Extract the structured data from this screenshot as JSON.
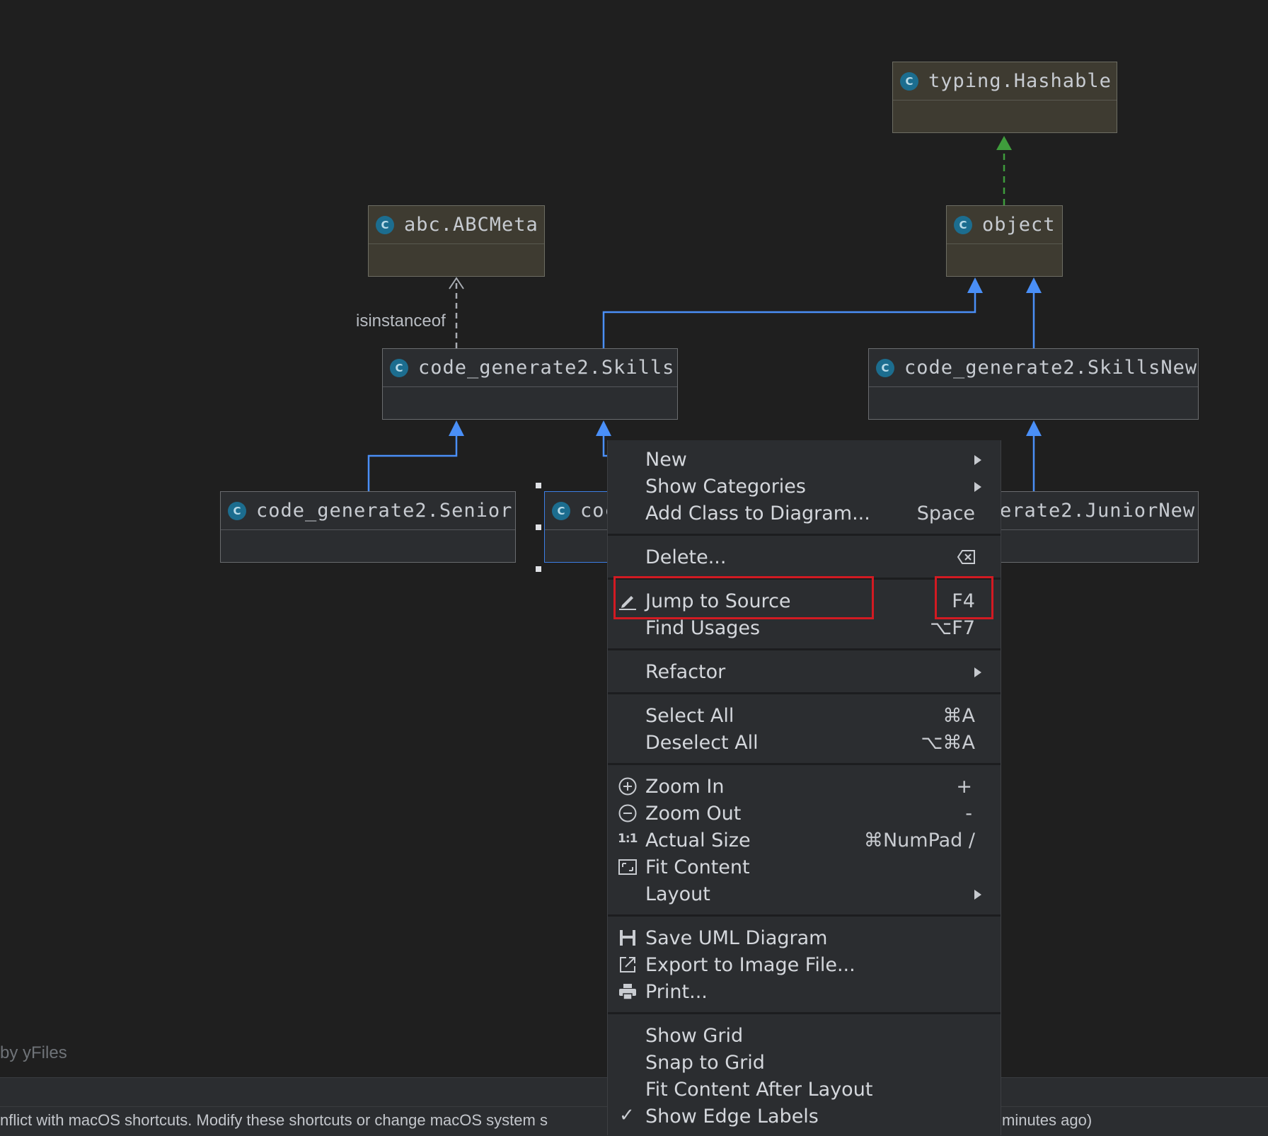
{
  "diagram": {
    "nodes": {
      "hashable": "typing.Hashable",
      "object": "object",
      "abcmeta": "abc.ABCMeta",
      "skills": "code_generate2.Skills",
      "skills_new": "code_generate2.SkillsNew",
      "senior": "code_generate2.Senior",
      "junior_partial": "coc",
      "junior_new_partial": "erate2.JuniorNew"
    },
    "class_icon_letter": "C",
    "edge_label": "isinstanceof",
    "colors": {
      "background": "#1f1f1f",
      "inherit_edge": "#4a8ff7",
      "implement_edge": "#3f9c3c",
      "dependency_edge": "#a9adb3"
    }
  },
  "watermark": "by yFiles",
  "status": {
    "left_text": "nflict with macOS shortcuts. Modify these shortcuts or change macOS system s",
    "right_text": "minutes ago)"
  },
  "context_menu": {
    "items": [
      {
        "label": "New",
        "submenu": true
      },
      {
        "label": "Show Categories",
        "submenu": true
      },
      {
        "label": "Add Class to Diagram...",
        "shortcut": "Space"
      },
      {
        "label": "Delete...",
        "icon": "delete-key-icon"
      },
      {
        "label": "Jump to Source",
        "shortcut": "F4",
        "icon": "pencil-icon",
        "highlighted": true
      },
      {
        "label": "Find Usages",
        "shortcut": "⌥F7"
      },
      {
        "label": "Refactor",
        "submenu": true
      },
      {
        "label": "Select All",
        "shortcut": "⌘A"
      },
      {
        "label": "Deselect All",
        "shortcut": "⌥⌘A"
      },
      {
        "label": "Zoom In",
        "shortcut": "+",
        "icon": "zoom-in-icon"
      },
      {
        "label": "Zoom Out",
        "shortcut": "-",
        "icon": "zoom-out-icon"
      },
      {
        "label": "Actual Size",
        "shortcut": "⌘NumPad /",
        "icon": "actual-size-icon",
        "icon_text": "1:1"
      },
      {
        "label": "Fit Content",
        "icon": "fit-content-icon"
      },
      {
        "label": "Layout",
        "submenu": true
      },
      {
        "label": "Save UML Diagram",
        "icon": "save-icon"
      },
      {
        "label": "Export to Image File...",
        "icon": "export-icon"
      },
      {
        "label": "Print...",
        "icon": "printer-icon"
      },
      {
        "label": "Show Grid"
      },
      {
        "label": "Snap to Grid"
      },
      {
        "label": "Fit Content After Layout"
      },
      {
        "label": "Show Edge Labels",
        "checked": true,
        "check_mark": "✓"
      }
    ],
    "highlight_color": "#d21a22"
  }
}
